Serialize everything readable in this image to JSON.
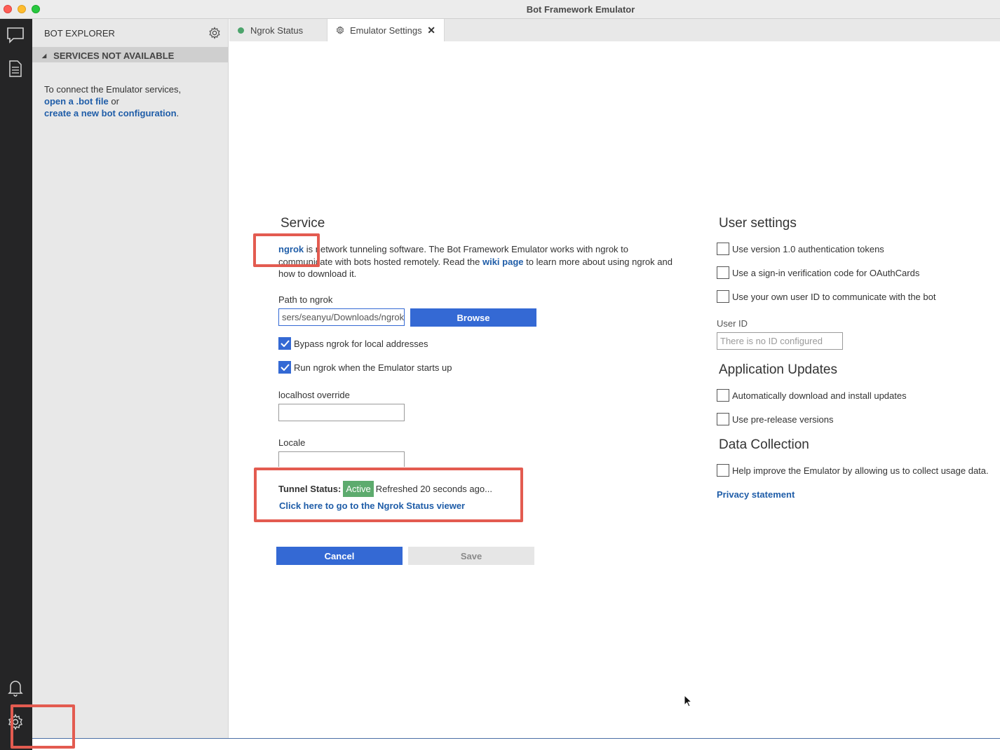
{
  "window": {
    "title": "Bot Framework Emulator"
  },
  "explorer": {
    "title": "BOT EXPLORER",
    "section": "SERVICES NOT AVAILABLE",
    "intro": "To connect the Emulator services,",
    "open_link": "open a .bot file",
    "or": " or",
    "create_link": "create a new bot configuration",
    "period": "."
  },
  "tabs": [
    {
      "label": "Ngrok Status",
      "status_color": "#4ca46c"
    },
    {
      "label": "Emulator Settings",
      "close": "✕"
    }
  ],
  "service": {
    "heading": "Service",
    "ngrok_link": "ngrok",
    "desc_1": " is network tunneling software. The Bot Framework Emulator works with ngrok to communicate with bots hosted remotely. Read the ",
    "wiki_link": "wiki page",
    "desc_2": " to learn more about using ngrok and how to download it.",
    "path_label": "Path to ngrok",
    "path_value": "sers/seanyu/Downloads/ngrok",
    "browse": "Browse",
    "bypass": "Bypass ngrok for local addresses",
    "run_on_start": "Run ngrok when the Emulator starts up",
    "localhost_label": "localhost override",
    "localhost_value": "",
    "locale_label": "Locale",
    "locale_value": "",
    "tunnel_label": "Tunnel Status:",
    "tunnel_state": "Active",
    "tunnel_refreshed": "Refreshed 20 seconds ago...",
    "viewer_link": "Click here to go to the Ngrok Status viewer",
    "cancel": "Cancel",
    "save": "Save"
  },
  "user_settings": {
    "heading": "User settings",
    "opt_v1_tokens": "Use version 1.0 authentication tokens",
    "opt_sign_in_code": "Use a sign-in verification code for OAuthCards",
    "opt_own_user_id": "Use your own user ID to communicate with the bot",
    "user_id_label": "User ID",
    "user_id_placeholder": "There is no ID configured"
  },
  "updates": {
    "heading": "Application Updates",
    "auto_download": "Automatically download and install updates",
    "prerelease": "Use pre-release versions"
  },
  "data_collection": {
    "heading": "Data Collection",
    "improve": "Help improve the Emulator by allowing us to collect usage data.",
    "privacy_link": "Privacy statement"
  },
  "colors": {
    "accent": "#3469d4",
    "link": "#1f5da8",
    "active": "#5dab6e",
    "highlight": "#e35b50"
  }
}
